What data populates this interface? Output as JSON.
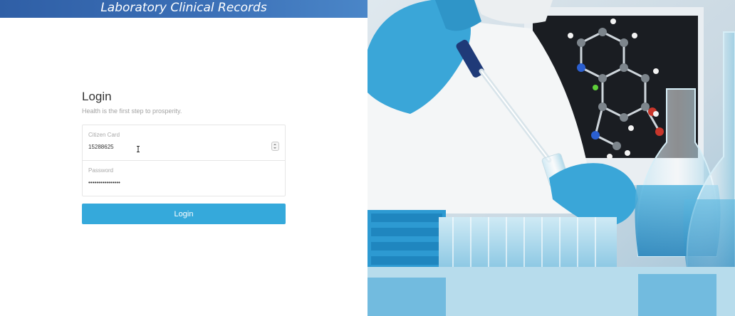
{
  "app": {
    "title": "Laboratory Clinical Records"
  },
  "login": {
    "heading": "Login",
    "subtitle": "Health is the first step to prosperity.",
    "citizen_card": {
      "label": "Citizen Card",
      "value": "15288625"
    },
    "password": {
      "label": "Password",
      "value": "••••••••••••••••"
    },
    "submit_label": "Login"
  },
  "image": {
    "icon": "laboratory-photo"
  }
}
